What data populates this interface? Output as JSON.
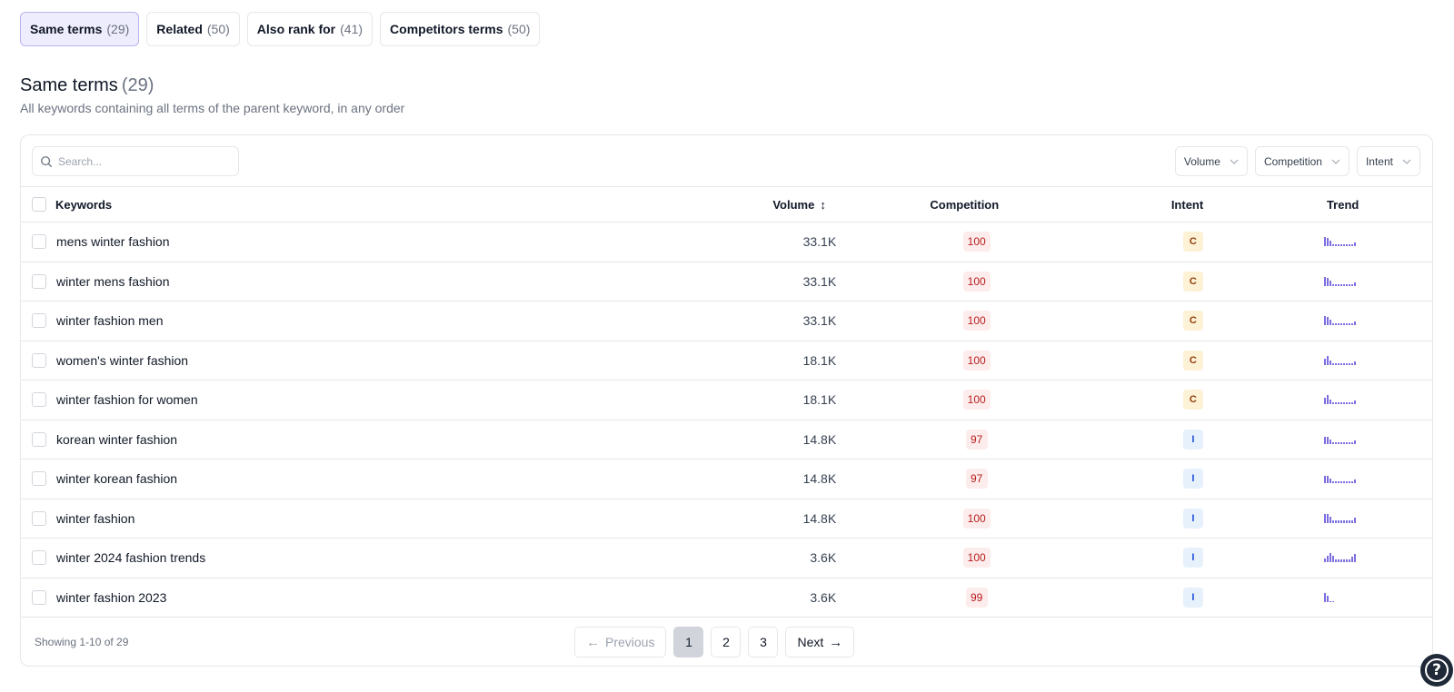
{
  "tabs": [
    {
      "label": "Same terms",
      "count": "(29)",
      "active": true
    },
    {
      "label": "Related",
      "count": "(50)",
      "active": false
    },
    {
      "label": "Also rank for",
      "count": "(41)",
      "active": false
    },
    {
      "label": "Competitors terms",
      "count": "(50)",
      "active": false
    }
  ],
  "section": {
    "title": "Same terms",
    "count": "(29)",
    "subtitle": "All keywords containing all terms of the parent keyword, in any order"
  },
  "search": {
    "placeholder": "Search...",
    "value": ""
  },
  "filters": [
    {
      "label": "Volume"
    },
    {
      "label": "Competition"
    },
    {
      "label": "Intent"
    }
  ],
  "table": {
    "headers": {
      "keywords": "Keywords",
      "volume": "Volume",
      "competition": "Competition",
      "intent": "Intent",
      "trend": "Trend"
    },
    "sort_icon": "↕",
    "rows": [
      {
        "keyword": "mens winter fashion",
        "volume": "33.1K",
        "competition": "100",
        "intent": "C",
        "trend": [
          1.0,
          0.9,
          0.6,
          0.15,
          0.15,
          0.15,
          0.15,
          0.15,
          0.15,
          0.15,
          0.15,
          0.4
        ]
      },
      {
        "keyword": "winter mens fashion",
        "volume": "33.1K",
        "competition": "100",
        "intent": "C",
        "trend": [
          1.0,
          0.9,
          0.6,
          0.15,
          0.15,
          0.15,
          0.15,
          0.15,
          0.15,
          0.15,
          0.15,
          0.4
        ]
      },
      {
        "keyword": "winter fashion men",
        "volume": "33.1K",
        "competition": "100",
        "intent": "C",
        "trend": [
          1.0,
          0.9,
          0.6,
          0.15,
          0.15,
          0.15,
          0.15,
          0.15,
          0.15,
          0.15,
          0.15,
          0.4
        ]
      },
      {
        "keyword": "women's winter fashion",
        "volume": "18.1K",
        "competition": "100",
        "intent": "C",
        "trend": [
          0.7,
          1.0,
          0.5,
          0.15,
          0.15,
          0.15,
          0.15,
          0.15,
          0.15,
          0.15,
          0.15,
          0.4
        ]
      },
      {
        "keyword": "winter fashion for women",
        "volume": "18.1K",
        "competition": "100",
        "intent": "C",
        "trend": [
          0.7,
          1.0,
          0.5,
          0.15,
          0.15,
          0.15,
          0.15,
          0.15,
          0.15,
          0.15,
          0.15,
          0.4
        ]
      },
      {
        "keyword": "korean winter fashion",
        "volume": "14.8K",
        "competition": "97",
        "intent": "I",
        "trend": [
          0.8,
          0.8,
          0.5,
          0.15,
          0.15,
          0.15,
          0.15,
          0.15,
          0.15,
          0.15,
          0.15,
          0.4
        ]
      },
      {
        "keyword": "winter korean fashion",
        "volume": "14.8K",
        "competition": "97",
        "intent": "I",
        "trend": [
          0.8,
          0.8,
          0.5,
          0.15,
          0.15,
          0.15,
          0.15,
          0.15,
          0.15,
          0.15,
          0.15,
          0.4
        ]
      },
      {
        "keyword": "winter fashion",
        "volume": "14.8K",
        "competition": "100",
        "intent": "I",
        "trend": [
          1.0,
          1.0,
          0.7,
          0.3,
          0.3,
          0.3,
          0.3,
          0.3,
          0.3,
          0.3,
          0.3,
          0.6
        ]
      },
      {
        "keyword": "winter 2024 fashion trends",
        "volume": "3.6K",
        "competition": "100",
        "intent": "I",
        "trend": [
          0.4,
          0.7,
          1.0,
          0.7,
          0.3,
          0.3,
          0.3,
          0.3,
          0.3,
          0.3,
          0.6,
          0.9
        ]
      },
      {
        "keyword": "winter fashion 2023",
        "volume": "3.6K",
        "competition": "99",
        "intent": "I",
        "trend": [
          1.0,
          0.7,
          0.1,
          0.1,
          0.0,
          0.0,
          0.0,
          0.0,
          0.0,
          0.0,
          0.0,
          0.0
        ]
      }
    ]
  },
  "footer": {
    "showing": "Showing 1-10 of 29",
    "previous": "Previous",
    "next": "Next",
    "pages": [
      "1",
      "2",
      "3"
    ],
    "current_page": "1"
  },
  "colors": {
    "accent": "#7c6fe0",
    "active_tab_bg": "#eeedfd",
    "competition_badge_bg": "#fdecec",
    "competition_badge_text": "#b91c1c",
    "intent_c_bg": "#fdf1d6",
    "intent_i_bg": "#e6f1fc"
  },
  "help_icon": "question-circle-icon"
}
